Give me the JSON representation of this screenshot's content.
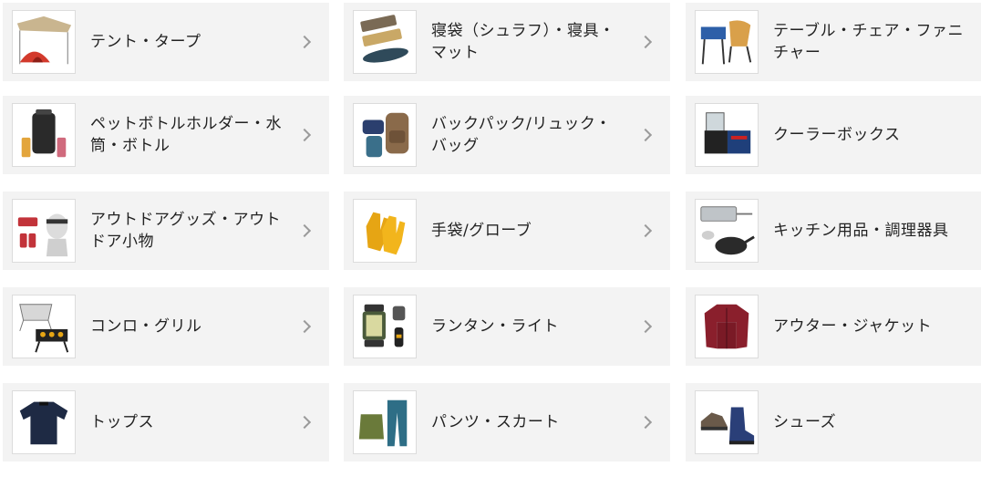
{
  "categories": [
    {
      "label": "テント・タープ",
      "icon": "tent-icon"
    },
    {
      "label": "寝袋（シュラフ）・寝具・マット",
      "icon": "sleeping-bag-icon"
    },
    {
      "label": "テーブル・チェア・ファニチャー",
      "icon": "table-chair-icon"
    },
    {
      "label": "ペットボトルホルダー・水筒・ボトル",
      "icon": "bottle-icon"
    },
    {
      "label": "バックパック/リュック・バッグ",
      "icon": "backpack-icon"
    },
    {
      "label": "クーラーボックス",
      "icon": "cooler-box-icon"
    },
    {
      "label": "アウトドアグッズ・アウトドア小物",
      "icon": "outdoor-goods-icon"
    },
    {
      "label": "手袋/グローブ",
      "icon": "gloves-icon"
    },
    {
      "label": "キッチン用品・調理器具",
      "icon": "cookware-icon"
    },
    {
      "label": "コンロ・グリル",
      "icon": "grill-icon"
    },
    {
      "label": "ランタン・ライト",
      "icon": "lantern-icon"
    },
    {
      "label": "アウター・ジャケット",
      "icon": "jacket-icon"
    },
    {
      "label": "トップス",
      "icon": "tops-icon"
    },
    {
      "label": "パンツ・スカート",
      "icon": "pants-icon"
    },
    {
      "label": "シューズ",
      "icon": "shoes-icon"
    }
  ],
  "chevron_icon": "chevron-right-icon",
  "colors": {
    "card_bg": "#f3f3f3",
    "text": "#222222",
    "chevron": "#9a9a9a",
    "thumb_border": "#dcdcdc"
  }
}
